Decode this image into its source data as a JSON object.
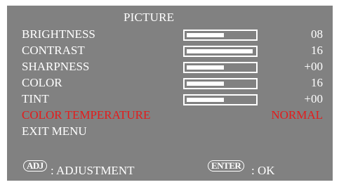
{
  "menu": {
    "title": "PICTURE",
    "items": [
      {
        "label": "BRIGHTNESS",
        "value": "08",
        "level": 0.55,
        "selected": false
      },
      {
        "label": "CONTRAST",
        "value": "16",
        "level": 0.98,
        "selected": false
      },
      {
        "label": "SHARPNESS",
        "value": "+00",
        "level": 0.55,
        "selected": false
      },
      {
        "label": "COLOR",
        "value": "16",
        "level": 0.55,
        "selected": false
      },
      {
        "label": "TINT",
        "value": "+00",
        "level": 0.55,
        "selected": false
      },
      {
        "label": "COLOR TEMPERATURE",
        "value": "NORMAL",
        "selected": true
      },
      {
        "label": "EXIT MENU",
        "selected": false
      }
    ]
  },
  "hints": {
    "adj_key": "ADJ",
    "adj_label": ": ADJUSTMENT",
    "enter_key": "ENTER",
    "enter_label": ": OK"
  },
  "colors": {
    "panel": "#818181",
    "text": "#ffffff",
    "selected": "#e41b1b"
  }
}
